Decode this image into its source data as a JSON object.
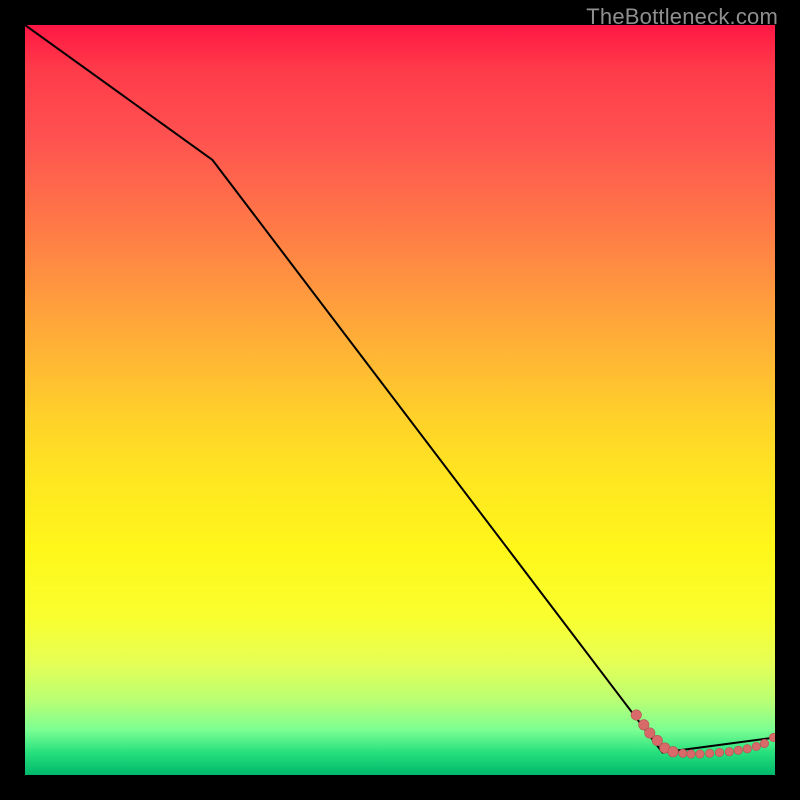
{
  "watermark": "TheBottleneck.com",
  "colors": {
    "line": "#000000",
    "marker": "#d86a6a",
    "marker_stroke": "#b45252"
  },
  "chart_data": {
    "type": "line",
    "title": "",
    "xlabel": "",
    "ylabel": "",
    "xlim": [
      0,
      100
    ],
    "ylim": [
      0,
      100
    ],
    "grid": false,
    "legend": false,
    "series": [
      {
        "name": "bottleneck-curve",
        "x": [
          0,
          25,
          85,
          100
        ],
        "y": [
          100,
          82,
          3,
          5
        ]
      }
    ],
    "markers": [
      {
        "x": 81.5,
        "y": 8.0
      },
      {
        "x": 82.5,
        "y": 6.7
      },
      {
        "x": 83.3,
        "y": 5.6
      },
      {
        "x": 84.3,
        "y": 4.6
      },
      {
        "x": 85.3,
        "y": 3.6
      },
      {
        "x": 86.4,
        "y": 3.1
      },
      {
        "x": 87.7,
        "y": 2.9
      },
      {
        "x": 88.8,
        "y": 2.8
      },
      {
        "x": 90.0,
        "y": 2.8
      },
      {
        "x": 91.3,
        "y": 2.9
      },
      {
        "x": 92.6,
        "y": 3.0
      },
      {
        "x": 93.9,
        "y": 3.1
      },
      {
        "x": 95.1,
        "y": 3.3
      },
      {
        "x": 96.3,
        "y": 3.5
      },
      {
        "x": 97.5,
        "y": 3.8
      },
      {
        "x": 98.6,
        "y": 4.2
      },
      {
        "x": 99.8,
        "y": 5.0
      }
    ]
  }
}
